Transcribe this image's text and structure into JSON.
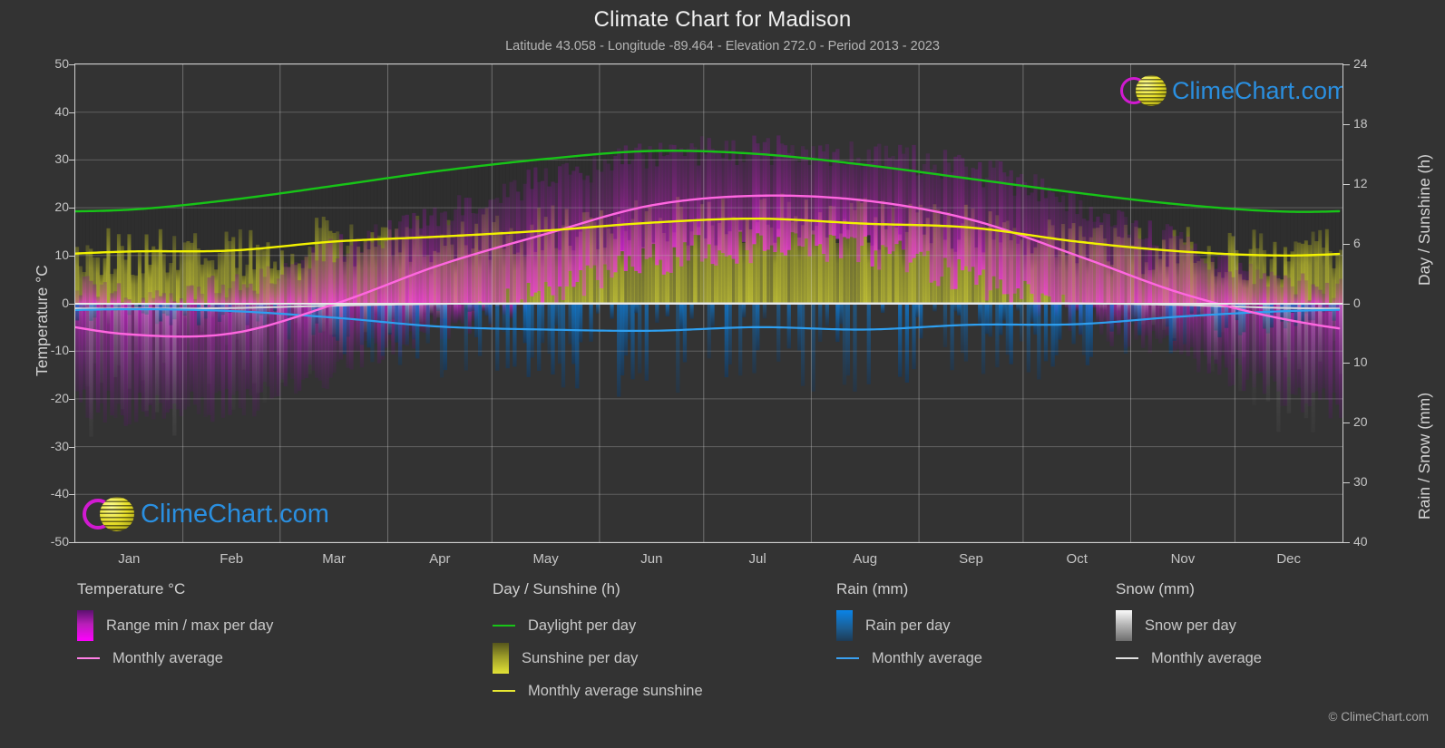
{
  "header": {
    "title": "Climate Chart for Madison",
    "subtitle": "Latitude 43.058 - Longitude -89.464 - Elevation 272.0 - Period 2013 - 2023"
  },
  "axes": {
    "left_title": "Temperature °C",
    "right_top_title": "Day / Sunshine (h)",
    "right_bottom_title": "Rain / Snow (mm)",
    "left_ticks": [
      "50",
      "40",
      "30",
      "20",
      "10",
      "0",
      "-10",
      "-20",
      "-30",
      "-40",
      "-50"
    ],
    "right_top_ticks": [
      "24",
      "18",
      "12",
      "6",
      "0"
    ],
    "right_bottom_ticks": [
      "0",
      "10",
      "20",
      "30",
      "40"
    ],
    "x_ticks": [
      "Jan",
      "Feb",
      "Mar",
      "Apr",
      "May",
      "Jun",
      "Jul",
      "Aug",
      "Sep",
      "Oct",
      "Nov",
      "Dec"
    ]
  },
  "legend": {
    "groups": [
      {
        "title": "Temperature °C",
        "items": [
          {
            "label": "Range min / max per day",
            "marker": "gradient-box",
            "color": "#ff00ff"
          },
          {
            "label": "Monthly average",
            "marker": "line",
            "color": "#ff7fe5"
          }
        ]
      },
      {
        "title": "Day / Sunshine (h)",
        "items": [
          {
            "label": "Daylight per day",
            "marker": "line",
            "color": "#17c417"
          },
          {
            "label": "Sunshine per day",
            "marker": "gradient-box",
            "color": "#e8e832"
          },
          {
            "label": "Monthly average sunshine",
            "marker": "line",
            "color": "#e8e832"
          }
        ]
      },
      {
        "title": "Rain (mm)",
        "items": [
          {
            "label": "Rain per day",
            "marker": "gradient-box",
            "color": "#0a84e8"
          },
          {
            "label": "Monthly average",
            "marker": "line",
            "color": "#3aa0f0"
          }
        ]
      },
      {
        "title": "Snow (mm)",
        "items": [
          {
            "label": "Snow per day",
            "marker": "gradient-box",
            "color": "#f0f0f0"
          },
          {
            "label": "Monthly average",
            "marker": "line",
            "color": "#e0e0e0"
          }
        ]
      }
    ],
    "copyright": "© ClimeChart.com"
  },
  "branding": {
    "name": "ClimeChart.com"
  },
  "colors": {
    "background": "#333333",
    "daylight": "#17c417",
    "sunshine_line": "#f2f200",
    "sunshine_fill": "#c5c52e",
    "temp_avg": "#ff66e0",
    "temp_range": "#cc00cc",
    "rain_avg": "#2e9ff0",
    "rain_fill": "#1a6fb0",
    "snow": "#d8d8d8",
    "zero_line": "#e8e8e8",
    "grid": "#8a8a8a",
    "text": "#c8c8c8"
  },
  "chart_data": {
    "type": "area",
    "title": "Climate Chart for Madison",
    "subtitle": "Latitude 43.058 - Longitude -89.464 - Elevation 272.0 - Period 2013 - 2023",
    "xlabel": "",
    "ylabel": "Temperature °C",
    "ylim": [
      -50,
      50
    ],
    "y2_top_label": "Day / Sunshine (h)",
    "y2_top_lim": [
      0,
      24
    ],
    "y2_bottom_label": "Rain / Snow (mm)",
    "y2_bottom_lim": [
      0,
      40
    ],
    "grid": true,
    "legend_position": "below",
    "categories": [
      "Jan",
      "Feb",
      "Mar",
      "Apr",
      "May",
      "Jun",
      "Jul",
      "Aug",
      "Sep",
      "Oct",
      "Nov",
      "Dec"
    ],
    "series": [
      {
        "name": "Monthly average temperature (°C)",
        "unit": "°C",
        "color": "#ff66e0",
        "axis": "left",
        "values": [
          -6.5,
          -6.3,
          -0.2,
          8.0,
          14.5,
          20.5,
          22.5,
          21.5,
          17.5,
          10.0,
          2.0,
          -3.5
        ]
      },
      {
        "name": "Daily max temperature envelope (°C)",
        "unit": "°C",
        "color": "#cc00cc",
        "axis": "left",
        "values": [
          2.0,
          3.5,
          11.0,
          19.0,
          26.0,
          31.0,
          32.0,
          31.0,
          28.0,
          21.0,
          12.0,
          4.0
        ]
      },
      {
        "name": "Daily min temperature envelope (°C)",
        "unit": "°C",
        "color": "#cc00cc",
        "axis": "left",
        "values": [
          -22.0,
          -21.0,
          -14.0,
          -5.0,
          2.0,
          9.0,
          12.0,
          11.0,
          5.0,
          -3.0,
          -11.0,
          -19.0
        ]
      },
      {
        "name": "Daylight per day (h)",
        "unit": "h",
        "color": "#17c417",
        "axis": "right_top",
        "values": [
          9.4,
          10.4,
          11.8,
          13.3,
          14.5,
          15.3,
          15.0,
          13.9,
          12.5,
          11.1,
          9.9,
          9.2
        ]
      },
      {
        "name": "Monthly average sunshine (h)",
        "unit": "h",
        "color": "#f2f200",
        "axis": "right_top",
        "values": [
          5.2,
          5.3,
          6.2,
          6.7,
          7.3,
          8.1,
          8.5,
          8.0,
          7.6,
          6.2,
          5.2,
          4.8
        ]
      },
      {
        "name": "Monthly average rain (mm)",
        "unit": "mm",
        "color": "#2e9ff0",
        "axis": "right_bottom",
        "values": [
          1.0,
          1.3,
          2.4,
          3.9,
          4.4,
          4.6,
          4.0,
          4.4,
          3.6,
          3.5,
          2.2,
          1.3
        ]
      },
      {
        "name": "Monthly average snow (mm)",
        "unit": "mm",
        "color": "#d8d8d8",
        "axis": "right_bottom",
        "values": [
          0.9,
          0.8,
          0.4,
          0.1,
          0.0,
          0.0,
          0.0,
          0.0,
          0.0,
          0.0,
          0.3,
          0.8
        ]
      }
    ]
  }
}
